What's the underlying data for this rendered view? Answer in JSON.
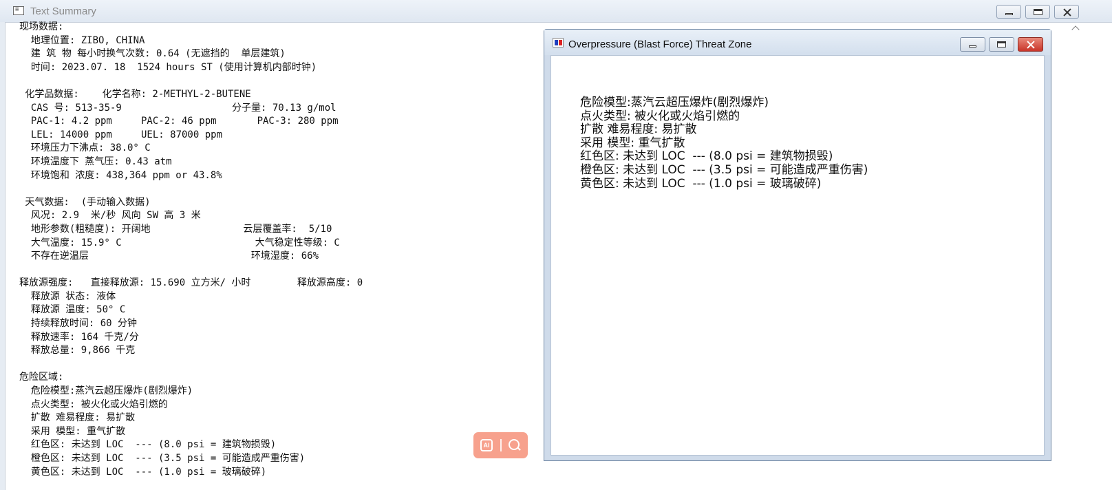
{
  "main_window": {
    "title": "Text Summary",
    "lines": [
      "现场数据:",
      "  地理位置: ZIBO, CHINA",
      "  建 筑 物 每小时换气次数: 0.64 (无遮挡的  单层建筑)",
      "  时间: 2023.07. 18  1524 hours ST (使用计算机内部时钟)",
      "",
      " 化学品数据:    化学名称: 2-METHYL-2-BUTENE",
      "  CAS 号: 513-35-9                   分子量: 70.13 g/mol",
      "  PAC-1: 4.2 ppm     PAC-2: 46 ppm       PAC-3: 280 ppm",
      "  LEL: 14000 ppm     UEL: 87000 ppm",
      "  环境压力下沸点: 38.0° C",
      "  环境温度下 蒸气压: 0.43 atm",
      "  环境饱和 浓度: 438,364 ppm or 43.8%",
      "",
      " 天气数据:  (手动输入数据)",
      "  风况: 2.9  米/秒 风向 SW 高 3 米",
      "  地形参数(粗糙度): 开阔地                云层覆盖率:  5/10",
      "  大气温度: 15.9° C                       大气稳定性等级: C",
      "  不存在逆温层                            环境湿度: 66%",
      "",
      "释放源强度:   直接释放源: 15.690 立方米/ 小时        释放源高度: 0",
      "  释放源 状态: 液体",
      "  释放源 温度: 50° C",
      "  持续释放时间: 60 分钟",
      "  释放速率: 164 千克/分",
      "  释放总量: 9,866 千克",
      "",
      "危险区域:",
      "  危险模型:蒸汽云超压爆炸(剧烈爆炸)",
      "  点火类型: 被火化或火焰引燃的",
      "  扩散 难易程度: 易扩散",
      "  采用 模型: 重气扩散",
      "  红色区: 未达到 LOC  --- (8.0 psi = 建筑物损毁)",
      "  橙色区: 未达到 LOC  --- (3.5 psi = 可能造成严重伤害)",
      "  黄色区: 未达到 LOC  --- (1.0 psi = 玻璃破碎)"
    ]
  },
  "threat_window": {
    "title": "Overpressure (Blast Force) Threat Zone",
    "lines": [
      "危险模型:蒸汽云超压爆炸(剧烈爆炸)",
      "点火类型: 被火化或火焰引燃的",
      "扩散 难易程度: 易扩散",
      "采用 模型: 重气扩散",
      "红色区: 未达到 LOC  --- (8.0 psi = 建筑物损毁)",
      "橙色区: 未达到 LOC  --- (3.5 psi = 可能造成严重伤害)",
      "黄色区: 未达到 LOC  --- (1.0 psi = 玻璃破碎)"
    ]
  },
  "toolbar": {
    "ai_icon_text": "AI"
  },
  "colors": {
    "toolbar_bg": "#f7a18d",
    "close_button": "#c9352a",
    "window_frame": "#cfdbea"
  },
  "icons": {
    "main_title": "app-window-icon",
    "threat_title": "aloha-threat-icon",
    "toolbar_ai": "ai-text-recognize-icon",
    "toolbar_search": "magnifier-icon"
  }
}
